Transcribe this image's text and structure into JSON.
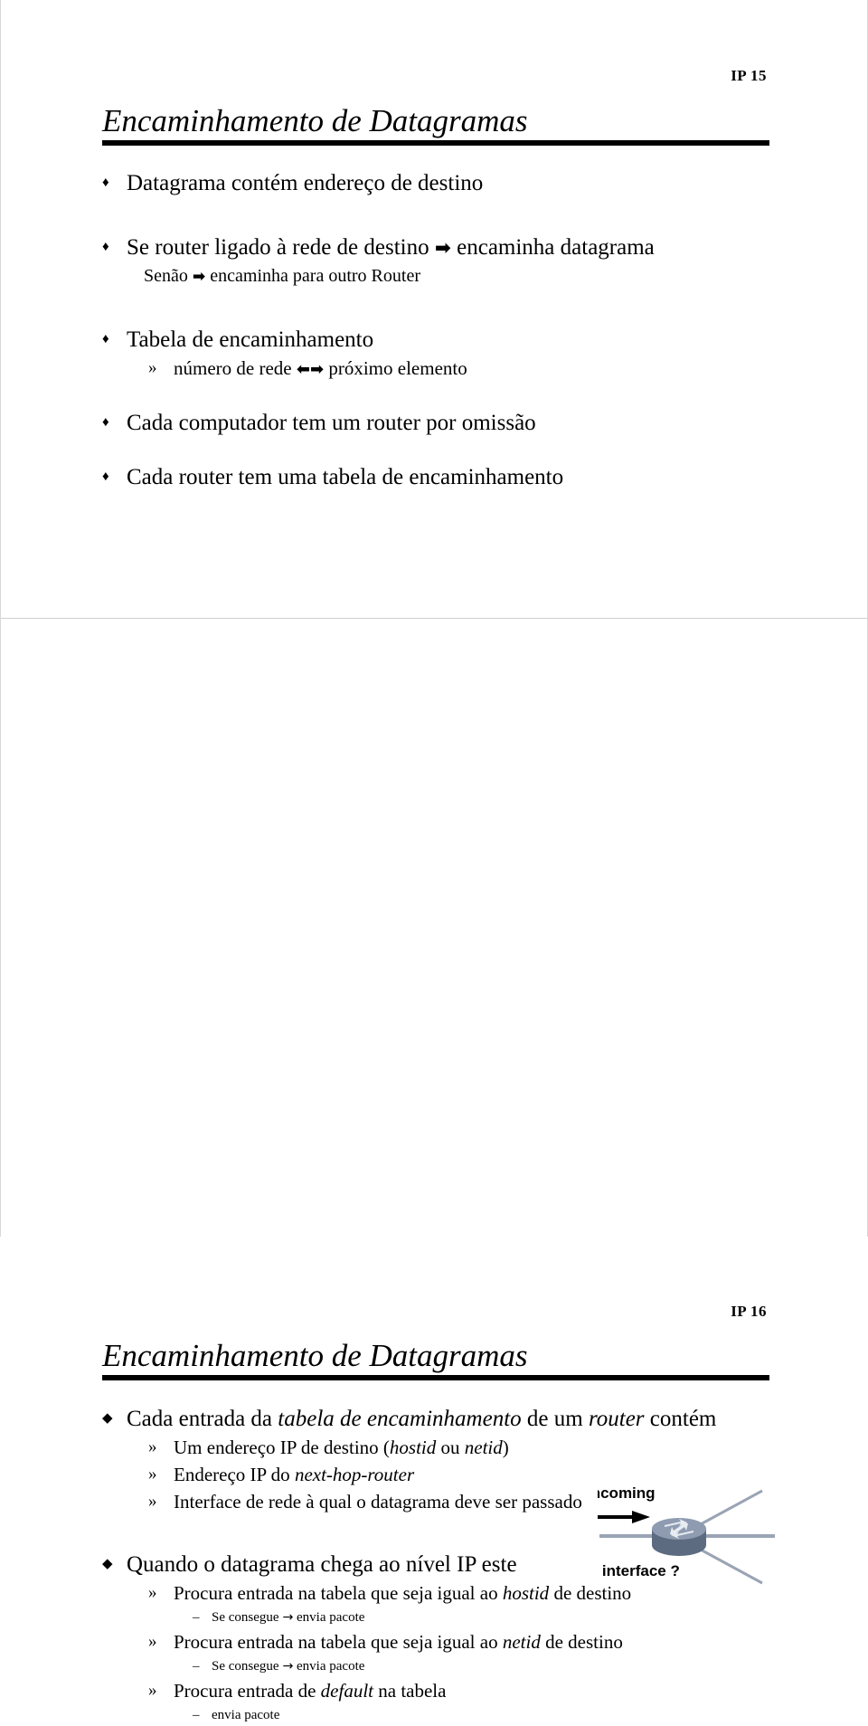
{
  "document": {
    "kind": "lecture-slide-handout",
    "page_background": "#ffffff"
  },
  "slides": [
    {
      "number_label": "IP 15",
      "title": "Encaminhamento de Datagramas",
      "bullets": {
        "b1": "Datagrama contém endereço de destino",
        "b2_a": "Se router ligado à rede de destino ",
        "b2_arrow": "➡",
        "b2_b": " encaminha datagrama",
        "b2_cont_a": "Senão ",
        "b2_cont_arrow": "➡",
        "b2_cont_b": " encaminha para outro Router",
        "b3": "Tabela de encaminhamento",
        "b3_sub_a": "número de rede ",
        "b3_sub_arrow": "⬅➡",
        "b3_sub_b": " próximo elemento",
        "b4": "Cada computador tem um router por omissão",
        "b5": "Cada router tem uma tabela de encaminhamento"
      },
      "markers": {
        "diamond": "♦",
        "double_angle": "»",
        "dash": "–"
      }
    },
    {
      "number_label": "IP 16",
      "title": "Encaminhamento de Datagramas",
      "bullets": {
        "b1_a": "Cada entrada da ",
        "b1_i1": "tabela de encaminhamento",
        "b1_b": " de um ",
        "b1_i2": "router",
        "b1_c": " contém",
        "s1_a": "Um endereço IP de destino (",
        "s1_i1": "hostid",
        "s1_b": " ou ",
        "s1_i2": "netid",
        "s1_c": ")",
        "s2_a": "Endereço IP do ",
        "s2_i1": "next-hop-router",
        "s3": "Interface de rede à qual o datagrama deve ser passado",
        "b2": "Quando o datagrama chega ao nível IP este",
        "s4_a": "Procura entrada na tabela que seja igual ao ",
        "s4_i1": "hostid",
        "s4_b": " de destino",
        "s4_sub_a": "Se consegue ",
        "s4_sub_arrow": "→",
        "s4_sub_b": " envia pacote",
        "s5_a": "Procura entrada na tabela que seja igual ao ",
        "s5_i1": "netid",
        "s5_b": " de destino",
        "s5_sub_a": "Se consegue ",
        "s5_sub_arrow": "→",
        "s5_sub_b": " envia pacote",
        "s6_a": "Procura entrada de ",
        "s6_i1": "default",
        "s6_b": " na tabela",
        "s6_sub": "envia pacote"
      },
      "figure": {
        "label_incoming": "incoming",
        "label_which_interface": "which interface ?",
        "colors": {
          "router_top": "#8e9bb0",
          "router_body": "#5c6b80",
          "link_line": "#9aa4b4",
          "arrow": "#000000"
        }
      }
    }
  ]
}
